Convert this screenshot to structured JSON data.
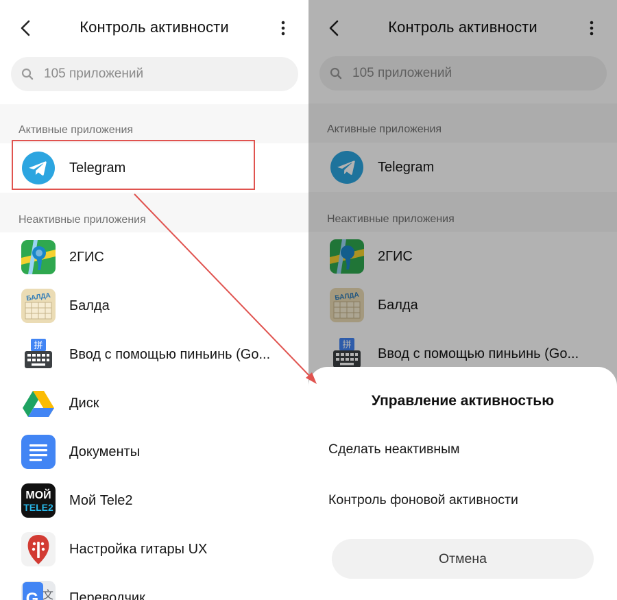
{
  "header": {
    "title": "Контроль активности"
  },
  "search": {
    "placeholder": "105 приложений"
  },
  "sections": {
    "active": "Активные приложения",
    "inactive": "Неактивные приложения"
  },
  "active_apps": [
    {
      "name": "Telegram",
      "icon": "telegram-icon"
    }
  ],
  "inactive_apps": [
    {
      "name": "2ГИС",
      "icon": "2gis-icon"
    },
    {
      "name": "Балда",
      "icon": "balda-icon"
    },
    {
      "name": "Ввод с помощью пиньинь (Go...",
      "icon": "pinyin-keyboard-icon"
    },
    {
      "name": "Диск",
      "icon": "drive-icon"
    },
    {
      "name": "Документы",
      "icon": "docs-icon"
    },
    {
      "name": "Мой Tele2",
      "icon": "tele2-icon"
    },
    {
      "name": "Настройка гитары UX",
      "icon": "guitar-tuner-icon"
    },
    {
      "name": "Переводчик",
      "icon": "translate-icon"
    }
  ],
  "icon_text": {
    "balda": "БАЛДА",
    "pinyin": "拼",
    "tele2_line1": "МОЙ",
    "tele2_line2": "TELE2",
    "translate_g": "G",
    "translate_char": "文"
  },
  "dialog": {
    "title": "Управление активностью",
    "option_1": "Сделать неактивным",
    "option_2": "Контроль фоновой активности",
    "cancel": "Отмена"
  },
  "colors": {
    "highlight": "#e0534f",
    "telegram": "#2ca5e0",
    "overlay": "rgba(0,0,0,0.30)"
  }
}
